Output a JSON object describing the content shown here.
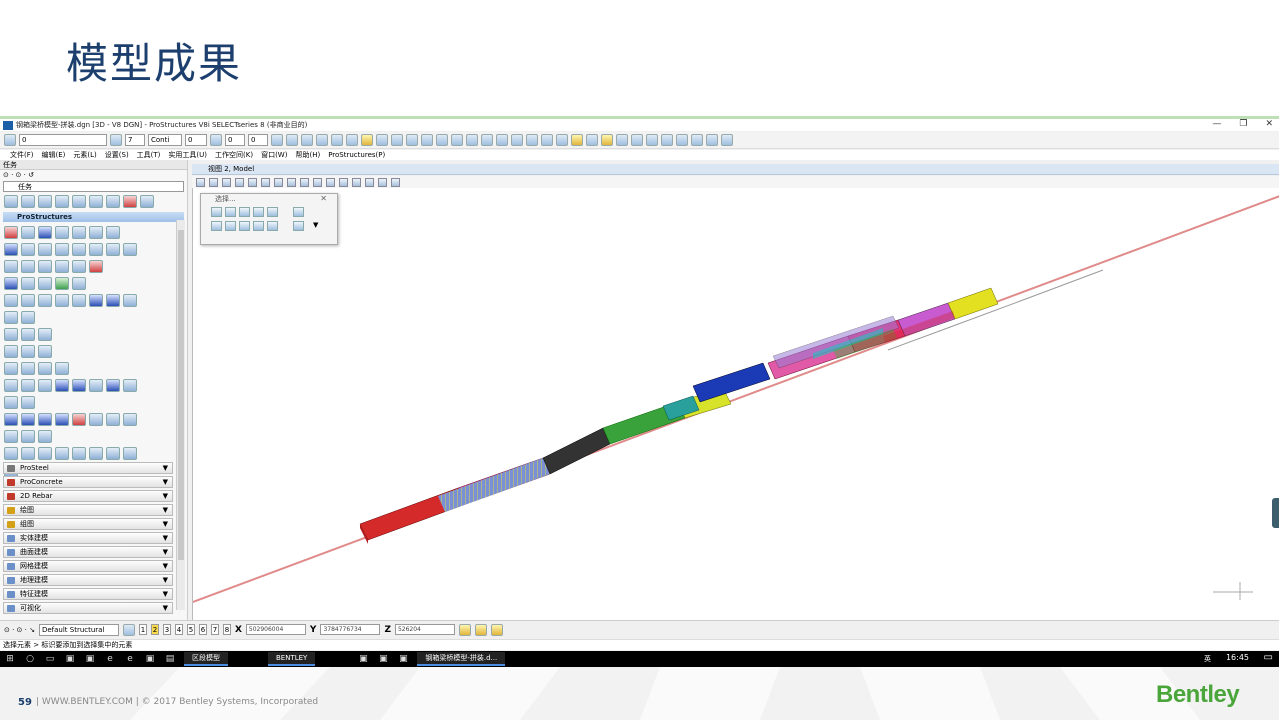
{
  "slide": {
    "title": "模型成果",
    "page_number": "59",
    "footer_text": "|   WWW.BENTLEY.COM   |   © 2017 Bentley Systems, Incorporated",
    "brand": "Bentley",
    "colors": {
      "title": "#1c3f6e",
      "brand": "#4aa63a",
      "line": "#bfe0b6"
    }
  },
  "window": {
    "title": "钢箱梁桥模型-拼装.dgn [3D - V8 DGN] - ProStructures V8i SELECTseries 8 (非商业目的)",
    "buttons": {
      "minimize": "—",
      "restore": "❐",
      "close": "✕"
    }
  },
  "toolbar": {
    "level_value": "0",
    "color_value": "7",
    "line_style_value": "Conti",
    "weight_value": "0",
    "transparency_value": "0",
    "priority_value": "0"
  },
  "menu": [
    "文件(F)",
    "编辑(E)",
    "元素(L)",
    "设置(S)",
    "工具(T)",
    "实用工具(U)",
    "工作空间(K)",
    "窗口(W)",
    "帮助(H)",
    "ProStructures(P)"
  ],
  "left_panel": {
    "header": "任务",
    "combo": "任务",
    "section": "ProStructures",
    "accordion": [
      "ProSteel",
      "ProConcrete",
      "2D Rebar",
      "绘图",
      "组图",
      "实体建模",
      "曲面建模",
      "网格建模",
      "地理建模",
      "特征建模",
      "可视化"
    ]
  },
  "view": {
    "title": "视图 2, Model",
    "palette_title": "选择..."
  },
  "statusbar": {
    "level_display": "Default Structural",
    "view_numbers": [
      "1",
      "2",
      "3",
      "4",
      "5",
      "6",
      "7",
      "8"
    ],
    "x_label": "X",
    "x_value": "502906004",
    "y_label": "Y",
    "y_value": "3784776734",
    "z_label": "Z",
    "z_value": "526204",
    "message": "选择元素 > 标识要添加到选择集中的元素"
  },
  "taskbar": {
    "apps": [
      "区段模型",
      "BENTLEY",
      "钢箱梁桥模型-拼装.d..."
    ],
    "time": "16:45",
    "lang": "英"
  }
}
